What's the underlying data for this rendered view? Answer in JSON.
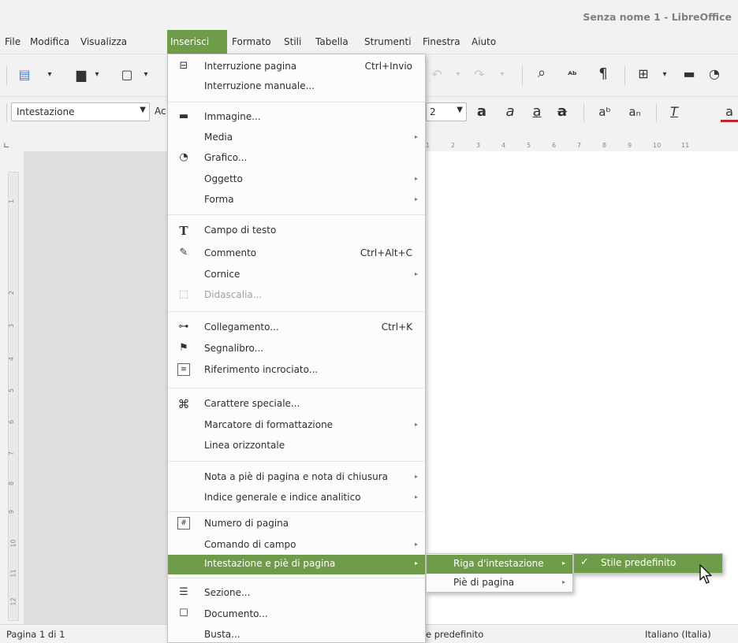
{
  "window": {
    "title": "Senza nome 1 - LibreOffice"
  },
  "menubar": {
    "items": [
      "File",
      "Modifica",
      "Visualizza",
      "Inserisci",
      "Formato",
      "Stili",
      "Tabella",
      "Strumenti",
      "Finestra",
      "Aiuto"
    ],
    "active": "Inserisci"
  },
  "toolbar2": {
    "paragraph_style": "Intestazione",
    "font_partial": "Ac",
    "font_size_partial": "2"
  },
  "ruler": {
    "numbers": [
      "1",
      "2",
      "3",
      "4",
      "5",
      "6",
      "7",
      "8",
      "9",
      "10",
      "11"
    ]
  },
  "vruler": {
    "numbers": [
      "1",
      "2",
      "3",
      "4",
      "5",
      "6",
      "7",
      "8",
      "9",
      "10",
      "11",
      "12"
    ]
  },
  "insert_menu": {
    "items": [
      {
        "label": "Interruzione pagina",
        "shortcut": "Ctrl+Invio",
        "icon": "page-break-icon"
      },
      {
        "label": "Interruzione manuale..."
      },
      {
        "label": "Immagine...",
        "icon": "image-icon"
      },
      {
        "label": "Media",
        "submenu": true
      },
      {
        "label": "Grafico...",
        "icon": "chart-icon"
      },
      {
        "label": "Oggetto",
        "submenu": true
      },
      {
        "label": "Forma",
        "submenu": true
      },
      {
        "label": "Campo di testo",
        "icon": "text-field-icon"
      },
      {
        "label": "Commento",
        "shortcut": "Ctrl+Alt+C",
        "icon": "comment-icon"
      },
      {
        "label": "Cornice",
        "submenu": true
      },
      {
        "label": "Didascalia...",
        "disabled": true,
        "icon": "caption-icon"
      },
      {
        "label": "Collegamento...",
        "shortcut": "Ctrl+K",
        "icon": "link-icon"
      },
      {
        "label": "Segnalibro...",
        "icon": "bookmark-icon"
      },
      {
        "label": "Riferimento incrociato...",
        "icon": "cross-reference-icon"
      },
      {
        "label": "Carattere speciale...",
        "icon": "special-character-icon"
      },
      {
        "label": "Marcatore di formattazione",
        "submenu": true
      },
      {
        "label": "Linea orizzontale"
      },
      {
        "label": "Nota a piè di pagina e nota di chiusura",
        "submenu": true
      },
      {
        "label": "Indice generale e indice analitico",
        "submenu": true
      },
      {
        "label": "Numero di pagina",
        "icon": "page-number-icon"
      },
      {
        "label": "Comando di campo",
        "submenu": true
      },
      {
        "label": "Intestazione e piè di pagina",
        "submenu": true,
        "highlighted": true
      },
      {
        "label": "Sezione...",
        "icon": "section-icon"
      },
      {
        "label": "Documento...",
        "icon": "document-icon"
      },
      {
        "label": "Busta..."
      }
    ]
  },
  "header_footer_submenu": {
    "items": [
      {
        "label": "Riga d'intestazione",
        "submenu": true,
        "highlighted": true
      },
      {
        "label": "Piè di pagina",
        "submenu": true
      }
    ]
  },
  "header_submenu": {
    "items": [
      {
        "label": "Stile predefinito",
        "checked": true
      }
    ]
  },
  "statusbar": {
    "page": "Pagina 1 di 1",
    "style": "e predefinito",
    "language": "Italiano (Italia)"
  },
  "colors": {
    "accent": "#6f9c48"
  }
}
